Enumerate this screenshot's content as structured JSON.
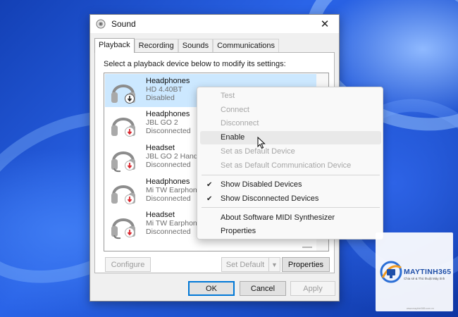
{
  "dialog": {
    "title": "Sound",
    "close_glyph": "✕",
    "tabs": [
      {
        "label": "Playback",
        "active": true
      },
      {
        "label": "Recording",
        "active": false
      },
      {
        "label": "Sounds",
        "active": false
      },
      {
        "label": "Communications",
        "active": false
      }
    ],
    "instruction": "Select a playback device below to modify its settings:",
    "devices": [
      {
        "name": "Headphones",
        "model": "HD 4.40BT",
        "status": "Disabled",
        "icon": "headphones-icon",
        "badge": "disabled-arrow-badge",
        "selected": true
      },
      {
        "name": "Headphones",
        "model": "JBL GO 2",
        "status": "Disconnected",
        "icon": "headphones-icon",
        "badge": "disconnected-arrow-badge",
        "selected": false
      },
      {
        "name": "Headset",
        "model": "JBL GO 2 Hands-",
        "status": "Disconnected",
        "icon": "headset-icon",
        "badge": "disconnected-arrow-badge",
        "selected": false
      },
      {
        "name": "Headphones",
        "model": "Mi TW Earphone",
        "status": "Disconnected",
        "icon": "headphones-icon",
        "badge": "disconnected-arrow-badge",
        "selected": false
      },
      {
        "name": "Headset",
        "model": "Mi TW Earphone",
        "status": "Disconnected",
        "icon": "headset-icon",
        "badge": "disconnected-arrow-badge",
        "selected": false
      }
    ],
    "buttons": {
      "configure": "Configure",
      "set_default": "Set Default",
      "properties": "Properties",
      "ok": "OK",
      "cancel": "Cancel",
      "apply": "Apply"
    }
  },
  "context_menu": {
    "items": [
      {
        "label": "Test",
        "enabled": false,
        "checked": false
      },
      {
        "label": "Connect",
        "enabled": false,
        "checked": false
      },
      {
        "label": "Disconnect",
        "enabled": false,
        "checked": false
      },
      {
        "label": "Enable",
        "enabled": true,
        "checked": false,
        "hover": true
      },
      {
        "label": "Set as Default Device",
        "enabled": false,
        "checked": false
      },
      {
        "label": "Set as Default Communication Device",
        "enabled": false,
        "checked": false
      },
      {
        "label": "Show Disabled Devices",
        "enabled": true,
        "checked": true
      },
      {
        "label": "Show Disconnected Devices",
        "enabled": true,
        "checked": true
      },
      {
        "label": "About Software MIDI Synthesizer",
        "enabled": true,
        "checked": false
      },
      {
        "label": "Properties",
        "enabled": true,
        "checked": false
      }
    ],
    "check_glyph": "✔"
  },
  "watermark": {
    "brand": "MAYTINH365",
    "tagline": "Chia sẻ & Thủ thuật Máy tính",
    "footer": "www.maytinh365.com.vn"
  },
  "colors": {
    "selection": "#cce8ff",
    "accent": "#0078d7",
    "badge_red": "#d9262d",
    "brand_blue": "#1f4fa8"
  }
}
